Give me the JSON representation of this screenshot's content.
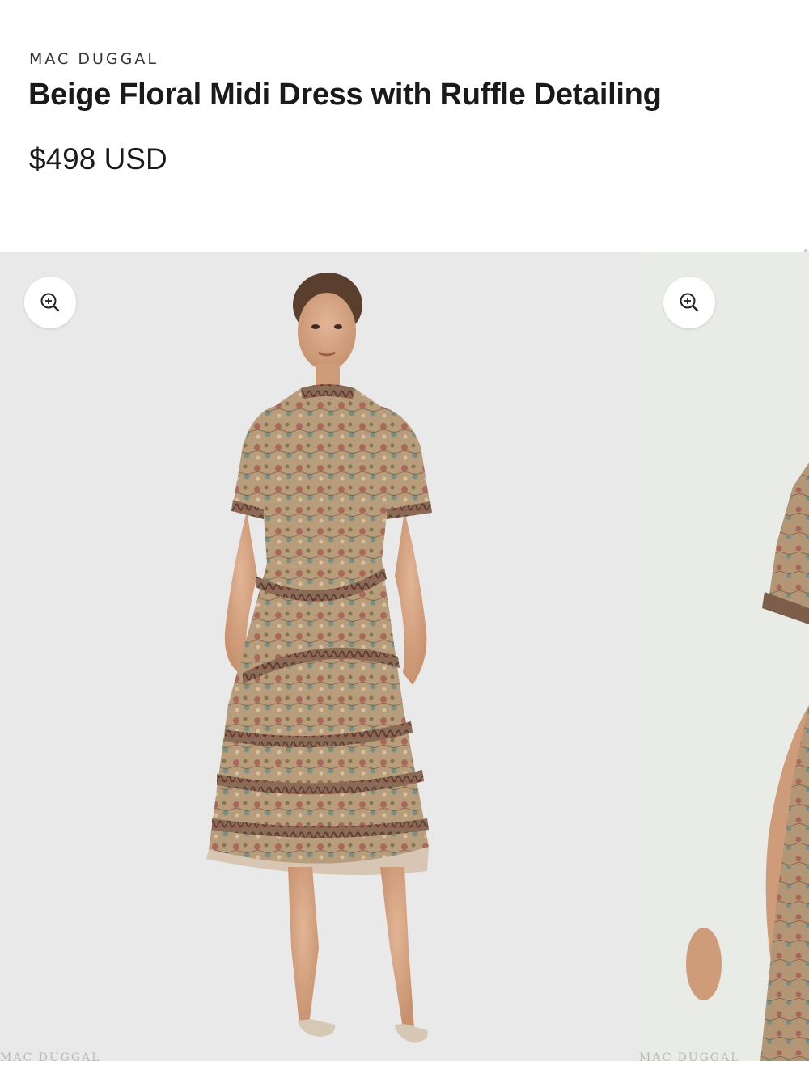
{
  "product": {
    "brand": "MAC DUGGAL",
    "title": "Beige Floral Midi Dress with Ruffle Detailing",
    "price": "$498 USD"
  },
  "gallery": {
    "slides": [
      {
        "zoom_icon": "zoom-in-icon",
        "watermark": "MAC DUGGAL"
      },
      {
        "zoom_icon": "zoom-in-icon",
        "watermark": "MAC DUGGAL"
      }
    ]
  },
  "colors": {
    "text": "#1a1a1a",
    "slide_1_bg": "#e9e9ea",
    "slide_2_bg": "#e8ebe6",
    "dress_base": "#b79c7c",
    "dress_floral_red": "#a5574f",
    "dress_floral_teal": "#5d8a86",
    "skin": "#d6a583"
  }
}
